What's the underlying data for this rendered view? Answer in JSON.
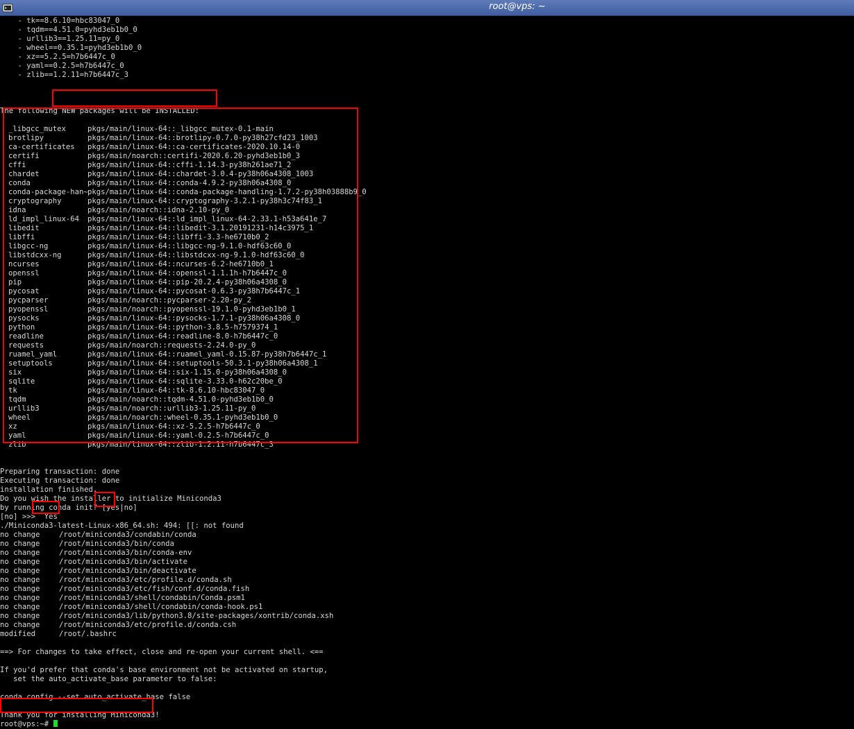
{
  "window": {
    "title": "root@vps: ~",
    "app_icon": "terminal-app-icon"
  },
  "top_lines": [
    "    - tk==8.6.10=hbc83047_0",
    "    - tqdm==4.51.0=pyhd3eb1b0_0",
    "    - urllib3==1.25.11=py_0",
    "    - wheel==0.35.1=pyhd3eb1b0_0",
    "    - xz==5.2.5=h7b6447c_0",
    "    - yaml==0.2.5=h7b6447c_0",
    "    - zlib==1.2.11=h7b6447c_3"
  ],
  "new_packages_header": "The following NEW packages will be INSTALLED:",
  "packages": [
    [
      "_libgcc_mutex",
      "pkgs/main/linux-64::_libgcc_mutex-0.1-main"
    ],
    [
      "brotlipy",
      "pkgs/main/linux-64::brotlipy-0.7.0-py38h27cfd23_1003"
    ],
    [
      "ca-certificates",
      "pkgs/main/linux-64::ca-certificates-2020.10.14-0"
    ],
    [
      "certifi",
      "pkgs/main/noarch::certifi-2020.6.20-pyhd3eb1b0_3"
    ],
    [
      "cffi",
      "pkgs/main/linux-64::cffi-1.14.3-py38h261ae71_2"
    ],
    [
      "chardet",
      "pkgs/main/linux-64::chardet-3.0.4-py38h06a4308_1003"
    ],
    [
      "conda",
      "pkgs/main/linux-64::conda-4.9.2-py38h06a4308_0"
    ],
    [
      "conda-package-han~",
      "pkgs/main/linux-64::conda-package-handling-1.7.2-py38h03888b9_0"
    ],
    [
      "cryptography",
      "pkgs/main/linux-64::cryptography-3.2.1-py38h3c74f83_1"
    ],
    [
      "idna",
      "pkgs/main/noarch::idna-2.10-py_0"
    ],
    [
      "ld_impl_linux-64",
      "pkgs/main/linux-64::ld_impl_linux-64-2.33.1-h53a641e_7"
    ],
    [
      "libedit",
      "pkgs/main/linux-64::libedit-3.1.20191231-h14c3975_1"
    ],
    [
      "libffi",
      "pkgs/main/linux-64::libffi-3.3-he6710b0_2"
    ],
    [
      "libgcc-ng",
      "pkgs/main/linux-64::libgcc-ng-9.1.0-hdf63c60_0"
    ],
    [
      "libstdcxx-ng",
      "pkgs/main/linux-64::libstdcxx-ng-9.1.0-hdf63c60_0"
    ],
    [
      "ncurses",
      "pkgs/main/linux-64::ncurses-6.2-he6710b0_1"
    ],
    [
      "openssl",
      "pkgs/main/linux-64::openssl-1.1.1h-h7b6447c_0"
    ],
    [
      "pip",
      "pkgs/main/linux-64::pip-20.2.4-py38h06a4308_0"
    ],
    [
      "pycosat",
      "pkgs/main/linux-64::pycosat-0.6.3-py38h7b6447c_1"
    ],
    [
      "pycparser",
      "pkgs/main/noarch::pycparser-2.20-py_2"
    ],
    [
      "pyopenssl",
      "pkgs/main/noarch::pyopenssl-19.1.0-pyhd3eb1b0_1"
    ],
    [
      "pysocks",
      "pkgs/main/linux-64::pysocks-1.7.1-py38h06a4308_0"
    ],
    [
      "python",
      "pkgs/main/linux-64::python-3.8.5-h7579374_1"
    ],
    [
      "readline",
      "pkgs/main/linux-64::readline-8.0-h7b6447c_0"
    ],
    [
      "requests",
      "pkgs/main/noarch::requests-2.24.0-py_0"
    ],
    [
      "ruamel_yaml",
      "pkgs/main/linux-64::ruamel_yaml-0.15.87-py38h7b6447c_1"
    ],
    [
      "setuptools",
      "pkgs/main/linux-64::setuptools-50.3.1-py38h06a4308_1"
    ],
    [
      "six",
      "pkgs/main/linux-64::six-1.15.0-py38h06a4308_0"
    ],
    [
      "sqlite",
      "pkgs/main/linux-64::sqlite-3.33.0-h62c20be_0"
    ],
    [
      "tk",
      "pkgs/main/linux-64::tk-8.6.10-hbc83047_0"
    ],
    [
      "tqdm",
      "pkgs/main/noarch::tqdm-4.51.0-pyhd3eb1b0_0"
    ],
    [
      "urllib3",
      "pkgs/main/noarch::urllib3-1.25.11-py_0"
    ],
    [
      "wheel",
      "pkgs/main/noarch::wheel-0.35.1-pyhd3eb1b0_0"
    ],
    [
      "xz",
      "pkgs/main/linux-64::xz-5.2.5-h7b6447c_0"
    ],
    [
      "yaml",
      "pkgs/main/linux-64::yaml-0.2.5-h7b6447c_0"
    ],
    [
      "zlib",
      "pkgs/main/linux-64::zlib-1.2.11-h7b6447c_3"
    ]
  ],
  "post_lines_1": [
    "Preparing transaction: done",
    "Executing transaction: done",
    "installation finished.",
    "Do you wish the installer to initialize Miniconda3",
    "by running conda init? [yes|no]"
  ],
  "prompt_line": {
    "prompt": "[no] >>> ",
    "answer": "Yes"
  },
  "error_line": "./Miniconda3-latest-Linux-x86_64.sh: 494: [[: not found",
  "changes": [
    [
      "no change",
      "/root/miniconda3/condabin/conda"
    ],
    [
      "no change",
      "/root/miniconda3/bin/conda"
    ],
    [
      "no change",
      "/root/miniconda3/bin/conda-env"
    ],
    [
      "no change",
      "/root/miniconda3/bin/activate"
    ],
    [
      "no change",
      "/root/miniconda3/bin/deactivate"
    ],
    [
      "no change",
      "/root/miniconda3/etc/profile.d/conda.sh"
    ],
    [
      "no change",
      "/root/miniconda3/etc/fish/conf.d/conda.fish"
    ],
    [
      "no change",
      "/root/miniconda3/shell/condabin/Conda.psm1"
    ],
    [
      "no change",
      "/root/miniconda3/shell/condabin/conda-hook.ps1"
    ],
    [
      "no change",
      "/root/miniconda3/lib/python3.8/site-packages/xontrib/conda.xsh"
    ],
    [
      "no change",
      "/root/miniconda3/etc/profile.d/conda.csh"
    ],
    [
      "modified",
      "/root/.bashrc"
    ]
  ],
  "effect_line": "==> For changes to take effect, close and re-open your current shell. <==",
  "prefer_lines": [
    "If you'd prefer that conda's base environment not be activated on startup,",
    "   set the auto_activate_base parameter to false:"
  ],
  "config_line": "conda config --set auto_activate_base false",
  "thanks_line": "Thank you for installing Miniconda3!",
  "shell_prompt": "root@vps:~# ",
  "colors": {
    "highlight": "#ff0000",
    "cursor": "#22dd22",
    "titlebar": "#4a67a8"
  }
}
